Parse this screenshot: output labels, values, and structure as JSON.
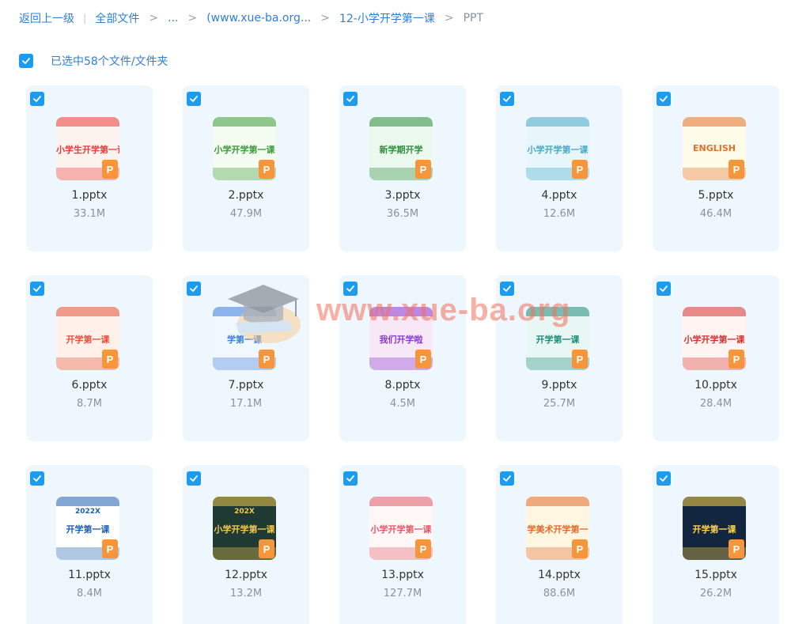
{
  "breadcrumb": {
    "back": "返回上一级",
    "all_files": "全部文件",
    "ellipsis": "...",
    "folder_a": "(www.xue-ba.org...",
    "folder_b": "12-小学开学第一课",
    "current": "PPT"
  },
  "selection": {
    "label": "已选中58个文件/文件夹",
    "checked": true
  },
  "files": [
    {
      "name": "1.pptx",
      "size": "33.1M",
      "thumb_title": "小学生开学第一课",
      "thumb_bg": "#fdf3ee",
      "thumb_accent": "#e83a3a"
    },
    {
      "name": "2.pptx",
      "size": "47.9M",
      "thumb_title": "小学开学第一课",
      "thumb_bg": "#f4fbf0",
      "thumb_accent": "#3a9a3a"
    },
    {
      "name": "3.pptx",
      "size": "36.5M",
      "thumb_title": "新学期开学",
      "thumb_bg": "#eaf8ee",
      "thumb_accent": "#2f8d3d"
    },
    {
      "name": "4.pptx",
      "size": "12.6M",
      "thumb_title": "小学开学第一课",
      "thumb_bg": "#e6f6fb",
      "thumb_accent": "#4aa8c8"
    },
    {
      "name": "5.pptx",
      "size": "46.4M",
      "thumb_title": "ENGLISH",
      "thumb_bg": "#fffbe9",
      "thumb_accent": "#e0702a"
    },
    {
      "name": "6.pptx",
      "size": "8.7M",
      "thumb_title": "开学第一课",
      "thumb_bg": "#fff1ea",
      "thumb_accent": "#e2503a"
    },
    {
      "name": "7.pptx",
      "size": "17.1M",
      "thumb_title": "学第一课",
      "thumb_bg": "#f1f7ff",
      "thumb_accent": "#3b7ed8"
    },
    {
      "name": "8.pptx",
      "size": "4.5M",
      "thumb_title": "我们开学啦",
      "thumb_bg": "#f8e7f6",
      "thumb_accent": "#8a3ad0"
    },
    {
      "name": "9.pptx",
      "size": "25.7M",
      "thumb_title": "开学第一课",
      "thumb_bg": "#e9f7f4",
      "thumb_accent": "#1f8c7c"
    },
    {
      "name": "10.pptx",
      "size": "28.4M",
      "thumb_title": "小学开学第一课",
      "thumb_bg": "#fff4f1",
      "thumb_accent": "#d23232"
    },
    {
      "name": "11.pptx",
      "size": "8.4M",
      "thumb_title": "开学第一课",
      "thumb_sub": "2022X",
      "thumb_bg": "#ffffff",
      "thumb_accent": "#1e5fb0"
    },
    {
      "name": "12.pptx",
      "size": "13.2M",
      "thumb_title": "小学开学第一课",
      "thumb_sub": "202X",
      "thumb_bg": "#1f3a33",
      "thumb_accent": "#f2c94c"
    },
    {
      "name": "13.pptx",
      "size": "127.7M",
      "thumb_title": "小学开学第一课",
      "thumb_bg": "#fff6f6",
      "thumb_accent": "#e05a6a"
    },
    {
      "name": "14.pptx",
      "size": "88.6M",
      "thumb_title": "学美术开学第一",
      "thumb_bg": "#fff6e2",
      "thumb_accent": "#e06a2a"
    },
    {
      "name": "15.pptx",
      "size": "26.2M",
      "thumb_title": "开学第一课",
      "thumb_bg": "#13263f",
      "thumb_accent": "#ffd54a"
    }
  ],
  "badge_letter": "P",
  "watermark": "www.xue-ba.org",
  "colors": {
    "accent": "#1c9bf0",
    "link": "#2f7fd8",
    "card_bg": "#eef6fe",
    "ppt_badge": "#f7953b"
  }
}
